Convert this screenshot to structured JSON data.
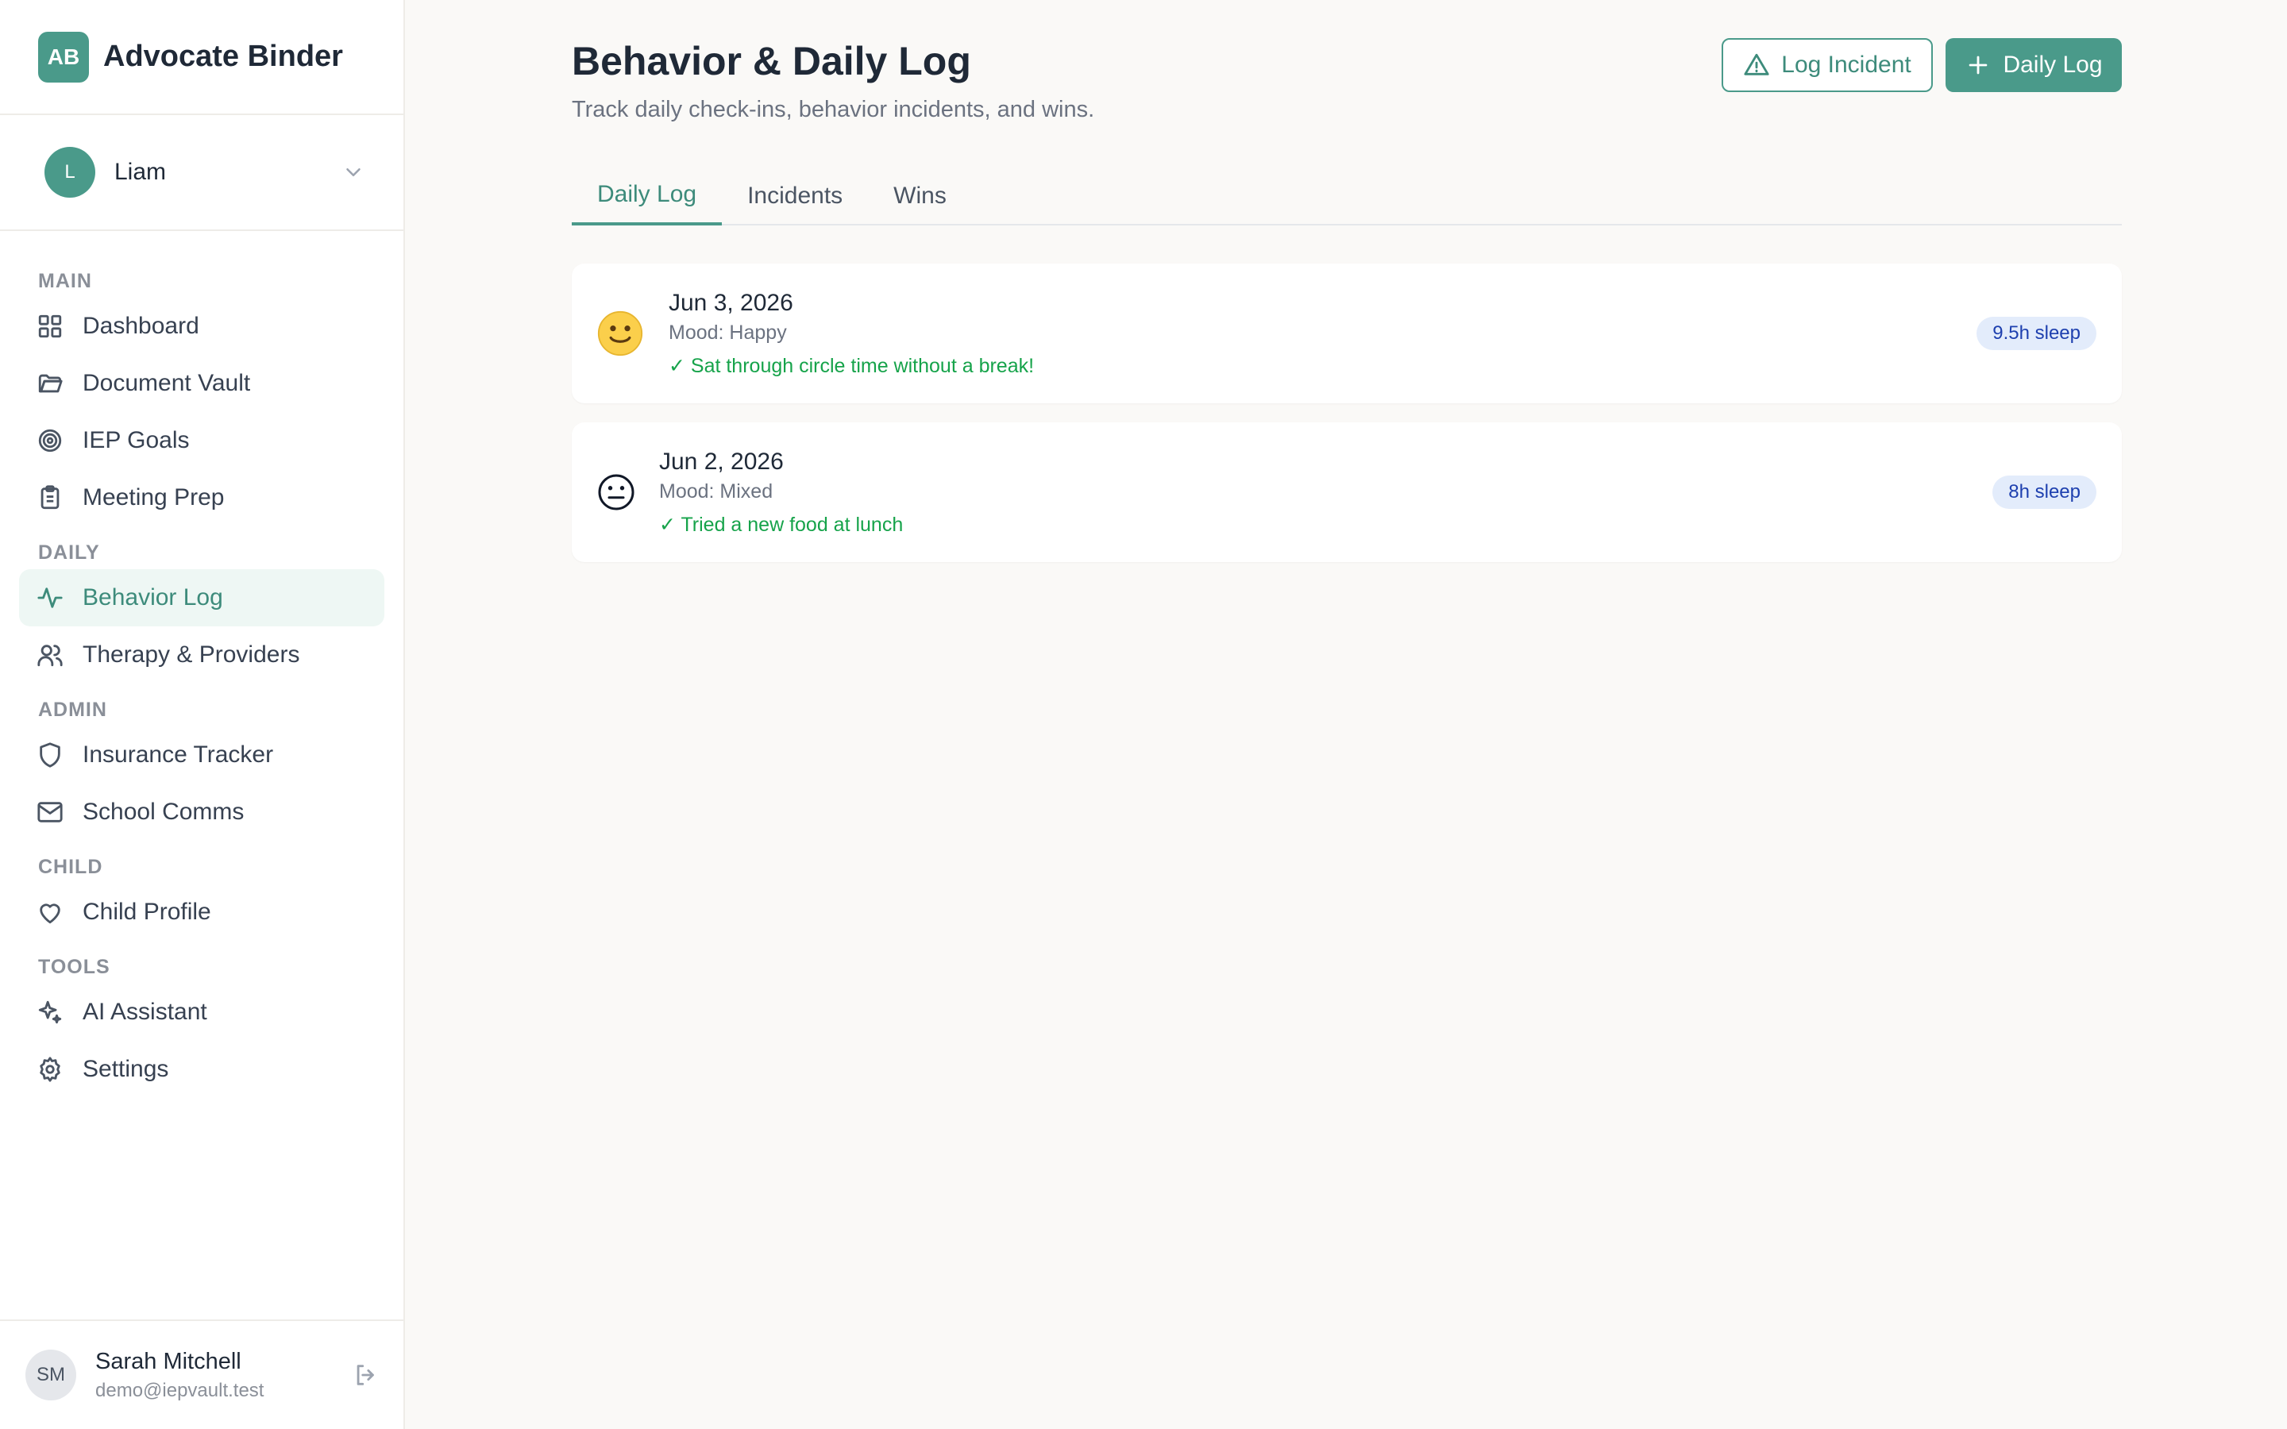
{
  "brand": {
    "logo": "AB",
    "name": "Advocate Binder"
  },
  "child": {
    "initial": "L",
    "name": "Liam"
  },
  "nav": {
    "sections": [
      {
        "title": "MAIN",
        "items": [
          {
            "label": "Dashboard",
            "icon": "grid-icon"
          },
          {
            "label": "Document Vault",
            "icon": "folder-icon"
          },
          {
            "label": "IEP Goals",
            "icon": "target-icon"
          },
          {
            "label": "Meeting Prep",
            "icon": "clipboard-icon"
          }
        ]
      },
      {
        "title": "DAILY",
        "items": [
          {
            "label": "Behavior Log",
            "icon": "activity-icon",
            "active": true
          },
          {
            "label": "Therapy & Providers",
            "icon": "users-icon"
          }
        ]
      },
      {
        "title": "ADMIN",
        "items": [
          {
            "label": "Insurance Tracker",
            "icon": "shield-icon"
          },
          {
            "label": "School Comms",
            "icon": "mail-icon"
          }
        ]
      },
      {
        "title": "CHILD",
        "items": [
          {
            "label": "Child Profile",
            "icon": "heart-icon"
          }
        ]
      },
      {
        "title": "TOOLS",
        "items": [
          {
            "label": "AI Assistant",
            "icon": "sparkle-icon"
          },
          {
            "label": "Settings",
            "icon": "gear-icon"
          }
        ]
      }
    ]
  },
  "user": {
    "initials": "SM",
    "name": "Sarah Mitchell",
    "email": "demo@iepvault.test"
  },
  "header": {
    "title": "Behavior & Daily Log",
    "subtitle": "Track daily check-ins, behavior incidents, and wins.",
    "log_incident_label": "Log Incident",
    "daily_log_label": "Daily Log"
  },
  "tabs": [
    {
      "label": "Daily Log",
      "active": true
    },
    {
      "label": "Incidents"
    },
    {
      "label": "Wins"
    }
  ],
  "entries": [
    {
      "mood_icon": "smiley-face-icon",
      "date": "Jun 3, 2026",
      "mood": "Mood: Happy",
      "win": "✓ Sat through circle time without a break!",
      "sleep": "9.5h sleep"
    },
    {
      "mood_icon": "neutral-face-icon",
      "date": "Jun 2, 2026",
      "mood": "Mood: Mixed",
      "win": "✓ Tried a new food at lunch",
      "sleep": "8h sleep"
    }
  ],
  "colors": {
    "accent": "#4a9a8a",
    "win": "#16a34a",
    "badge_bg": "#e3ecfb",
    "badge_text": "#1e40af"
  }
}
